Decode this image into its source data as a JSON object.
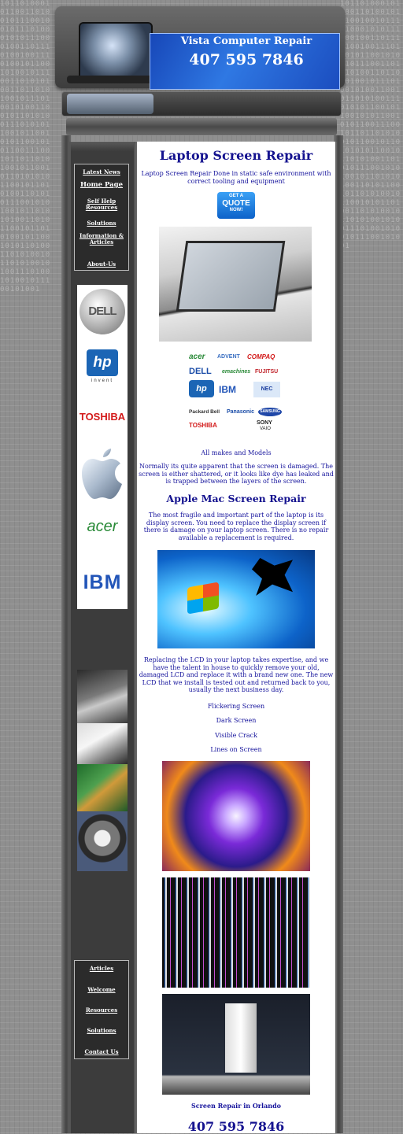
{
  "background_binary": "10110100010110011010010111001001011101000101011100010011011101001001110100101100101001011100110101010011011010100101110100101001100101101010011101010110010110010101100101011001110010110110101001011001011010101011001011010100110101011100101010010110101010011010110010110101001011001010110100110101001011010100101001110100101001011100101001",
  "header": {
    "company_name": "Vista Computer Repair",
    "phone": "407 595 7846"
  },
  "sidebar_menu": [
    {
      "label": "Latest News"
    },
    {
      "label": "Home Page"
    },
    {
      "label": "Self Help Resources"
    },
    {
      "label": "Solutions"
    },
    {
      "label": "Information & Articles"
    },
    {
      "label": "About-Us"
    }
  ],
  "sidebar_brand_logos": {
    "dell": "DELL",
    "hp": "hp",
    "hp_tag": "invent",
    "toshiba": "TOSHIBA",
    "apple": "apple-logo-icon",
    "acer": "acer",
    "ibm": "IBM"
  },
  "sidebar_menu_bottom": [
    {
      "label": "Articles"
    },
    {
      "label": "Welcome"
    },
    {
      "label": "Resources"
    },
    {
      "label": "Solutions"
    },
    {
      "label": "Contact Us"
    }
  ],
  "main": {
    "title": "Laptop Screen Repair",
    "intro": "Laptop Screen Repair Done in static safe environment with correct tooling and equipment",
    "quote_button": {
      "line1": "GET A",
      "line2": "QUOTE",
      "line3": "NOW!"
    },
    "brand_logos": [
      "acer",
      "ADVENT",
      "COMPAQ",
      "DELL",
      "emachines",
      "FUJITSU",
      "hp",
      "IBM",
      "NEC",
      "Packard Bell",
      "Panasonic",
      "SAMSUNG",
      "TOSHIBA",
      "SONY",
      "VAIO"
    ],
    "all_makes": "All makes and Models",
    "damage_text": "Normally its quite apparent that the screen is damaged. The screen is either shattered, or it looks like dye has leaked and is trapped between the layers of the screen.",
    "apple_title": "Apple Mac Screen Repair",
    "apple_text": "The most fragile and important part of the laptop is its display screen. You need to replace the display screen if there is damage on your laptop screen.  There is no repair available a replacement is required.",
    "lcd_text": "Replacing the LCD in your laptop takes expertise, and we have the talent in house to quickly remove your old, damaged LCD and replace it with a brand new one. The new LCD that we install is tested out and returned back to you, usually the next business day.",
    "symptoms": [
      "Flickering Screen",
      "Dark Screen",
      "Visible Crack",
      "Lines on Screen"
    ],
    "footer_label": "Screen Repair in Orlando",
    "footer_phone": "407 595 7846"
  },
  "colors": {
    "link_blue": "#15139c",
    "sidebar_dark": "#3c3c3c",
    "banner_blue": "#1f5fd0"
  }
}
